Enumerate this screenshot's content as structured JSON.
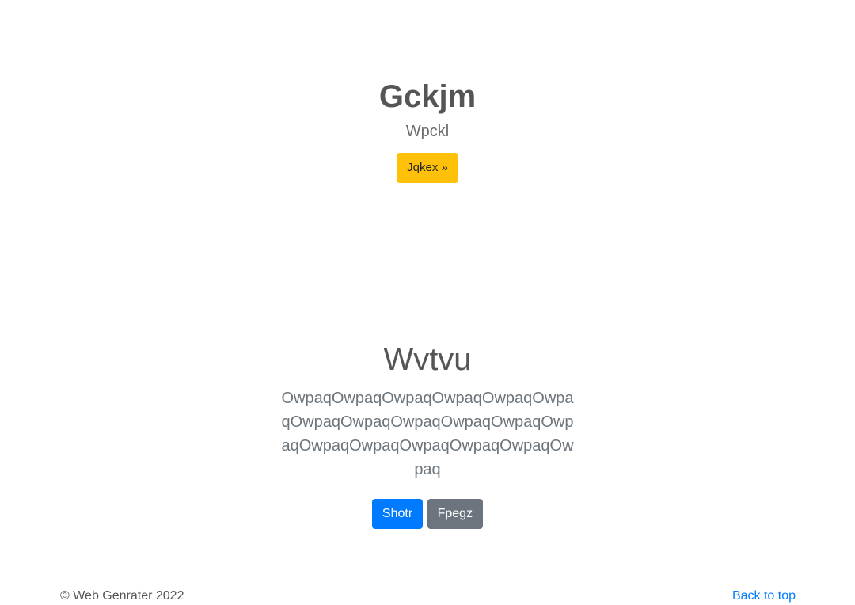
{
  "hero": {
    "title": "Gckjm",
    "subtitle": "Wpckl",
    "button_label": "Jqkex »"
  },
  "section": {
    "title": "Wvtvu",
    "lead": "OwpaqOwpaqOwpaqOwpaqOwpaqOwpaqOwpaqOwpaqOwpaqOwpaqOwpaqOwpaqOwpaqOwpaqOwpaqOwpaqOwpaqOwpaq",
    "primary_button_label": "Shotr",
    "secondary_button_label": "Fpegz"
  },
  "footer": {
    "copyright": "© Web Genrater 2022",
    "back_to_top_label": "Back to top"
  },
  "colors": {
    "warning": "#ffc107",
    "primary": "#007bff",
    "secondary": "#6c757d",
    "link": "#007bff"
  }
}
